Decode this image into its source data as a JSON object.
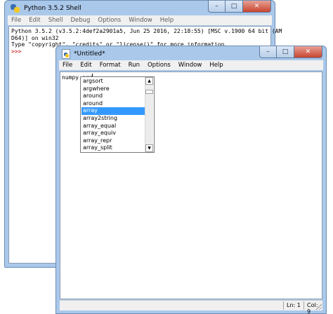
{
  "shell": {
    "title": "Python 3.5.2 Shell",
    "menu": [
      "File",
      "Edit",
      "Shell",
      "Debug",
      "Options",
      "Window",
      "Help"
    ],
    "output_lines": [
      "Python 3.5.2 (v3.5.2:4def2a2901a5, Jun 25 2016, 22:18:55) [MSC v.1900 64 bit (AM",
      "D64)] on win32",
      "Type \"copyright\", \"credits\" or \"license()\" for more information."
    ],
    "prompt": ">>>"
  },
  "editor": {
    "title": "*Untitled*",
    "menu": [
      "File",
      "Edit",
      "Format",
      "Run",
      "Options",
      "Window",
      "Help"
    ],
    "code": "numpy.arr",
    "status": {
      "line": "Ln: 1",
      "col": "Col: 9"
    }
  },
  "window_controls": {
    "minimize": "–",
    "maximize": "□",
    "close": "✕"
  },
  "autocomplete": {
    "items": [
      "argsort",
      "argwhere",
      "around",
      "around",
      "array",
      "array2string",
      "array_equal",
      "array_equiv",
      "array_repr",
      "array_split"
    ],
    "selected_index": 4,
    "scroll_up": "▲",
    "scroll_down": "▼"
  },
  "colors": {
    "titlebar_frame": "#aac8ea",
    "selection": "#3399ff",
    "prompt": "#c00000",
    "close_button": "#c8452f"
  }
}
